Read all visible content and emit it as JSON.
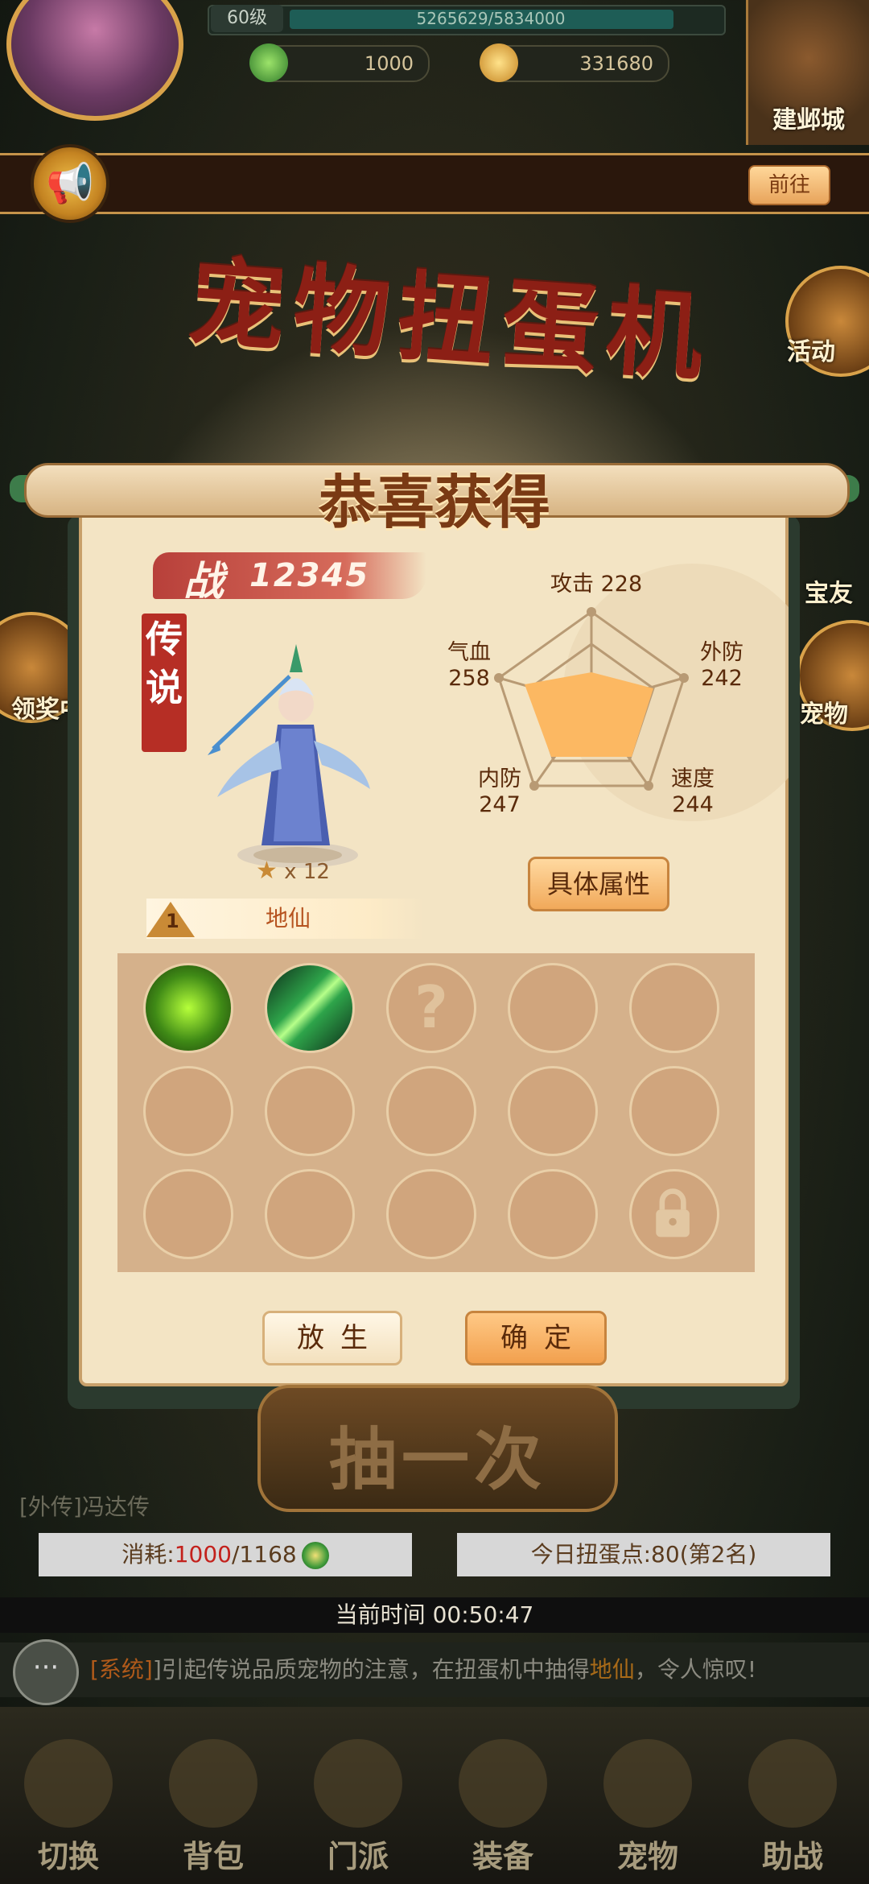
{
  "top": {
    "level": "60级",
    "exp": "5265629/5834000",
    "exp_progress": 0.9,
    "currency_jade": "1000",
    "currency_gold": "331680",
    "mail_label": "建邺城"
  },
  "notice": {
    "goto_label": "前往"
  },
  "page_title": "宠物扭蛋机",
  "side": {
    "left_label": "领奖中",
    "right_top_label": "活动",
    "right_mid_label": "宝友",
    "right_bot_label": "宠物"
  },
  "dialog": {
    "title": "恭喜获得",
    "power_prefix": "战",
    "power": "12345",
    "legend_tag": [
      "传",
      "说"
    ],
    "star_count": "x 12",
    "rank_icon": "1",
    "rank_name": "地仙",
    "stats": {
      "attack": {
        "label": "攻击",
        "value": "228"
      },
      "ext_def": {
        "label": "外防",
        "value": "242"
      },
      "speed": {
        "label": "速度",
        "value": "244"
      },
      "int_def": {
        "label": "内防",
        "value": "247"
      },
      "hp": {
        "label": "气血",
        "value": "258"
      }
    },
    "detail_label": "具体属性",
    "release_label": "放生",
    "confirm_label": "确定"
  },
  "draw_label": "抽一次",
  "bg_pet_name": "[外传]冯达传",
  "cost": {
    "prefix": "消耗:",
    "value": "1000",
    "suffix": "/1168"
  },
  "points_text": "今日扭蛋点:80(第2名)",
  "time_text": "当前时间 00:50:47",
  "system_msg": {
    "tag": "[系统]",
    "text_a": "]引起传说品质宠物的注意，在扭蛋机中抽得",
    "highlight": "地仙",
    "text_b": "，令人惊叹!"
  },
  "nav": [
    "切换",
    "背包",
    "门派",
    "装备",
    "宠物",
    "助战"
  ],
  "colors": {
    "accent": "#b62e25",
    "button": "#f1a95a",
    "panel": "#f3e4c4"
  }
}
